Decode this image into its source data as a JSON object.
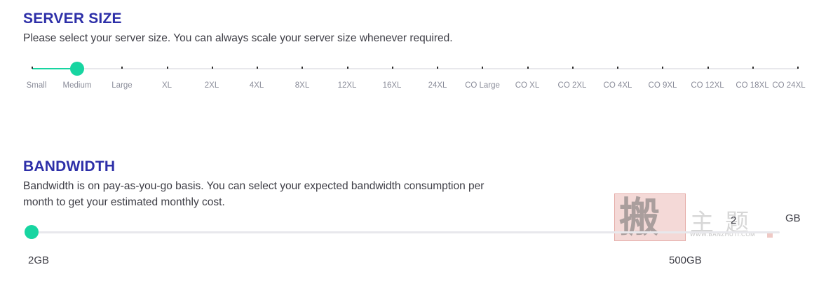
{
  "server_size": {
    "title": "SERVER SIZE",
    "description": "Please select your server size. You can always scale your server size whenever required.",
    "options": [
      "Small",
      "Medium",
      "Large",
      "XL",
      "2XL",
      "4XL",
      "8XL",
      "12XL",
      "16XL",
      "24XL",
      "CO Large",
      "CO XL",
      "CO 2XL",
      "CO 4XL",
      "CO 9XL",
      "CO 12XL",
      "CO 18XL",
      "CO 24XL"
    ],
    "selected_index": 1,
    "accent_color": "#17d5a1"
  },
  "bandwidth": {
    "title": "BANDWIDTH",
    "description_line1": "Bandwidth is on pay-as-you-go basis. You can select your expected bandwidth consumption per",
    "description_line2": "month to get your estimated monthly cost.",
    "min_label": "2GB",
    "max_label": "500GB",
    "value": "2",
    "unit": "GB",
    "slider_fraction": 0,
    "accent_color": "#17d5a1"
  },
  "watermark": {
    "seal_char": "搬",
    "chars": "主题",
    "url": "WWW.BANZHUTI.COM"
  }
}
